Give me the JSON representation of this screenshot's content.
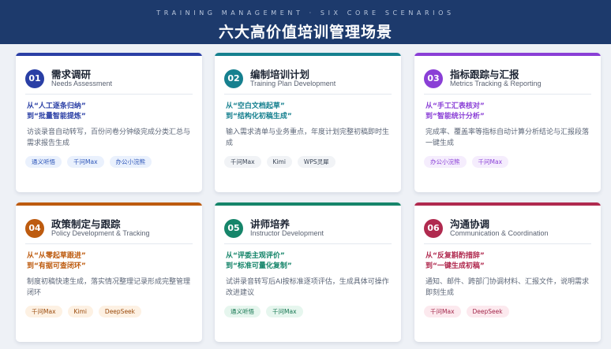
{
  "header": {
    "subtitle": "TRAINING MANAGEMENT · SIX CORE SCENARIOS",
    "title": "六大高价值培训管理场景"
  },
  "cards": [
    {
      "number": "01",
      "title_cn": "需求调研",
      "title_en": "Needs Assessment",
      "from": "从“人工逐条归纳”",
      "to": "到“批量智能提炼”",
      "desc": "访谈录音自动转写，百份问卷分钟级完成分类汇总与需求报告生成",
      "tags": [
        "通义听悟",
        "千问Max",
        "办公小浣熊"
      ],
      "accent": "#2a3fa5",
      "tag_bg": "#eaf1fd",
      "tag_fg": "#2c55b8"
    },
    {
      "number": "02",
      "title_cn": "编制培训计划",
      "title_en": "Training Plan Development",
      "from": "从“空白文档起草”",
      "to": "到“结构化初稿生成”",
      "desc": "输入需求清单与业务重点，年度计划完整初稿即时生成",
      "tags": [
        "千问Max",
        "Kimi",
        "WPS灵犀"
      ],
      "accent": "#16808f",
      "tag_bg": "#f1f3f6",
      "tag_fg": "#3a4556"
    },
    {
      "number": "03",
      "title_cn": "指标跟踪与汇报",
      "title_en": "Metrics Tracking & Reporting",
      "from": "从“手工汇表核对”",
      "to": "到“智能统计分析”",
      "desc": "完成率、覆盖率等指标自动计算分析结论与汇报段落一键生成",
      "tags": [
        "办公小浣熊",
        "千问Max"
      ],
      "accent": "#8a3fd6",
      "tag_bg": "#f5edfd",
      "tag_fg": "#8a3fd6"
    },
    {
      "number": "04",
      "title_cn": "政策制定与跟踪",
      "title_en": "Policy Development & Tracking",
      "from": "从“从零起草跟进”",
      "to": "到“有据可查闭环”",
      "desc": "制度初稿快速生成，落实情况整理记录形成完整管理闭环",
      "tags": [
        "千问Max",
        "Kimi",
        "DeepSeek"
      ],
      "accent": "#bd5b0f",
      "tag_bg": "#fdf1e3",
      "tag_fg": "#9a4a0c"
    },
    {
      "number": "05",
      "title_cn": "讲师培养",
      "title_en": "Instructor Development",
      "from": "从“评委主观评价”",
      "to": "到“标准可量化复制”",
      "desc": "试讲录音转写后AI按标准逐项评估，生成具体可操作改进建议",
      "tags": [
        "通义听悟",
        "千问Max"
      ],
      "accent": "#16856a",
      "tag_bg": "#e6f6ee",
      "tag_fg": "#147550"
    },
    {
      "number": "06",
      "title_cn": "沟通协调",
      "title_en": "Communication & Coordination",
      "from": "从“反复斟酌措辞”",
      "to": "到“一键生成初稿”",
      "desc": "通知、邮件、跨部门协调材料、汇报文件，说明需求即刻生成",
      "tags": [
        "千问Max",
        "DeepSeek"
      ],
      "accent": "#b02a4f",
      "tag_bg": "#fce9ee",
      "tag_fg": "#a3284b"
    }
  ]
}
